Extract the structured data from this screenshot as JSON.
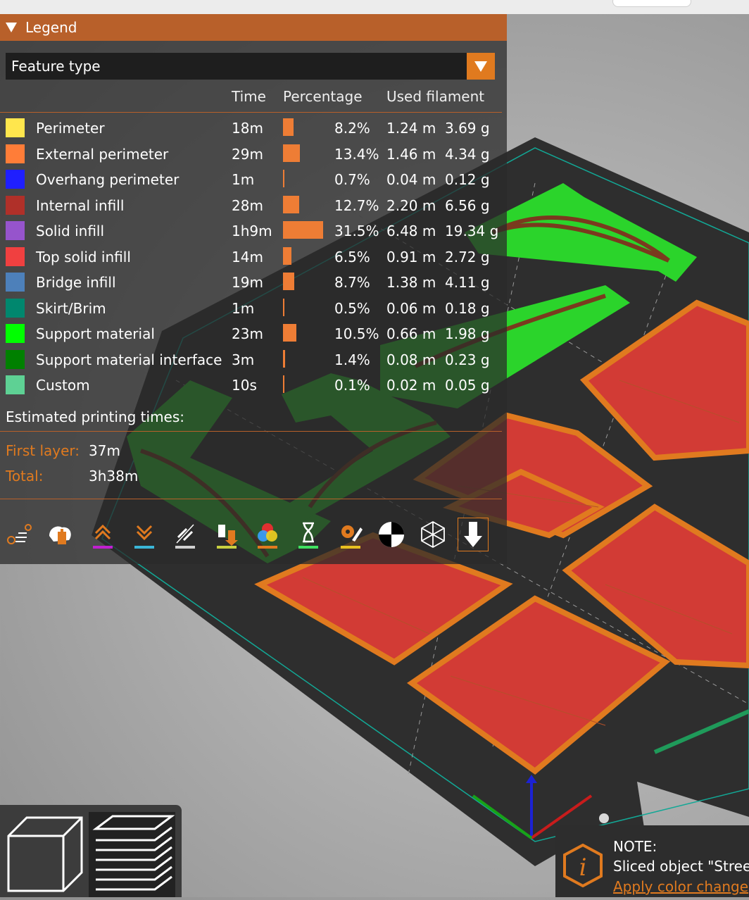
{
  "legend": {
    "title": "Legend",
    "view_type": "Feature type",
    "columns": {
      "time": "Time",
      "percentage": "Percentage",
      "used_filament": "Used filament"
    },
    "rows": [
      {
        "name": "Perimeter",
        "color": "#FFE64D",
        "time": "18m",
        "percent": "8.2%",
        "length": "1.24 m",
        "weight": "3.69 g",
        "share": 0.082
      },
      {
        "name": "External perimeter",
        "color": "#FF7D38",
        "time": "29m",
        "percent": "13.4%",
        "length": "1.46 m",
        "weight": "4.34 g",
        "share": 0.134
      },
      {
        "name": "Overhang perimeter",
        "color": "#1F1FFF",
        "time": "1m",
        "percent": "0.7%",
        "length": "0.04 m",
        "weight": "0.12 g",
        "share": 0.007
      },
      {
        "name": "Internal infill",
        "color": "#B03029",
        "time": "28m",
        "percent": "12.7%",
        "length": "2.20 m",
        "weight": "6.56 g",
        "share": 0.127
      },
      {
        "name": "Solid infill",
        "color": "#9654CC",
        "time": "1h9m",
        "percent": "31.5%",
        "length": "6.48 m",
        "weight": "19.34 g",
        "share": 0.315
      },
      {
        "name": "Top solid infill",
        "color": "#F04040",
        "time": "14m",
        "percent": "6.5%",
        "length": "0.91 m",
        "weight": "2.72 g",
        "share": 0.065
      },
      {
        "name": "Bridge infill",
        "color": "#4D80BA",
        "time": "19m",
        "percent": "8.7%",
        "length": "1.38 m",
        "weight": "4.11 g",
        "share": 0.087
      },
      {
        "name": "Skirt/Brim",
        "color": "#00876E",
        "time": "1m",
        "percent": "0.5%",
        "length": "0.06 m",
        "weight": "0.18 g",
        "share": 0.005
      },
      {
        "name": "Support material",
        "color": "#00FF00",
        "time": "23m",
        "percent": "10.5%",
        "length": "0.66 m",
        "weight": "1.98 g",
        "share": 0.105
      },
      {
        "name": "Support material interface",
        "color": "#008000",
        "time": "3m",
        "percent": "1.4%",
        "length": "0.08 m",
        "weight": "0.23 g",
        "share": 0.014
      },
      {
        "name": "Custom",
        "color": "#5ED194",
        "time": "10s",
        "percent": "0.1%",
        "length": "0.02 m",
        "weight": "0.05 g",
        "share": 0.001
      }
    ],
    "estimated_title": "Estimated printing times:",
    "first_layer_label": "First layer:",
    "first_layer_value": "37m",
    "total_label": "Total:",
    "total_value": "3h38m",
    "toolbar_icons": [
      "travel-icon",
      "wipe-icon",
      "retractions-icon",
      "deretractions-icon",
      "seams-icon",
      "tool-changes-icon",
      "color-changes-icon",
      "pause-icon",
      "custom-gcode-icon",
      "center-of-gravity-icon",
      "shells-icon",
      "tool-marker-icon"
    ]
  },
  "note": {
    "title": "NOTE:",
    "text": "Sliced object \"Street",
    "link": "Apply color change"
  },
  "colors": {
    "accent": "#E07A1F",
    "header": "#B8602A"
  }
}
